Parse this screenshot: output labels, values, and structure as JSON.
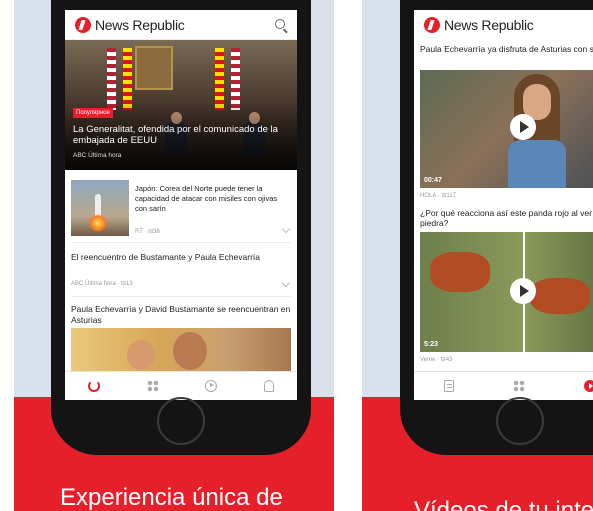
{
  "left_screen": {
    "brand": "News Republic",
    "hero": {
      "tag": "Популярное",
      "title": "La Generalitat, ofendida por el comunicado de la embajada de EEUU",
      "meta": "ABC Última hora"
    },
    "articles": [
      {
        "title": "Japón: Corea del Norte puede tener la capacidad de atacar con misiles con ojivas con sarín",
        "meta": "RT · ⊟36"
      },
      {
        "title": "El reencuentro de Bustamante y Paula Echevarría",
        "meta": "ABC Última hora · ⊟13"
      },
      {
        "title": "Paula Echevarría y David Bustamante se reencuentran en Asturias",
        "meta": ""
      }
    ],
    "nav": [
      "refresh-icon",
      "grid-icon",
      "play-icon",
      "user-icon"
    ]
  },
  "right_screen": {
    "brand": "News Republic",
    "videos": [
      {
        "title": "Paula Echevarría ya disfruta de Asturias con su familia",
        "duration": "00:47",
        "meta": "HOLA · ⊟117"
      },
      {
        "title": "¿Por qué reacciona así este panda rojo al ver una piedra?",
        "duration": "5:23",
        "meta": "Veme · ⊟43"
      }
    ],
    "nav": [
      "document-icon",
      "grid-icon",
      "play-icon"
    ]
  },
  "promo": {
    "left": "Experiencia única de",
    "right": "Vídeos de tu inte"
  },
  "colors": {
    "accent": "#e5202b",
    "panel": "#d9e1ed"
  }
}
